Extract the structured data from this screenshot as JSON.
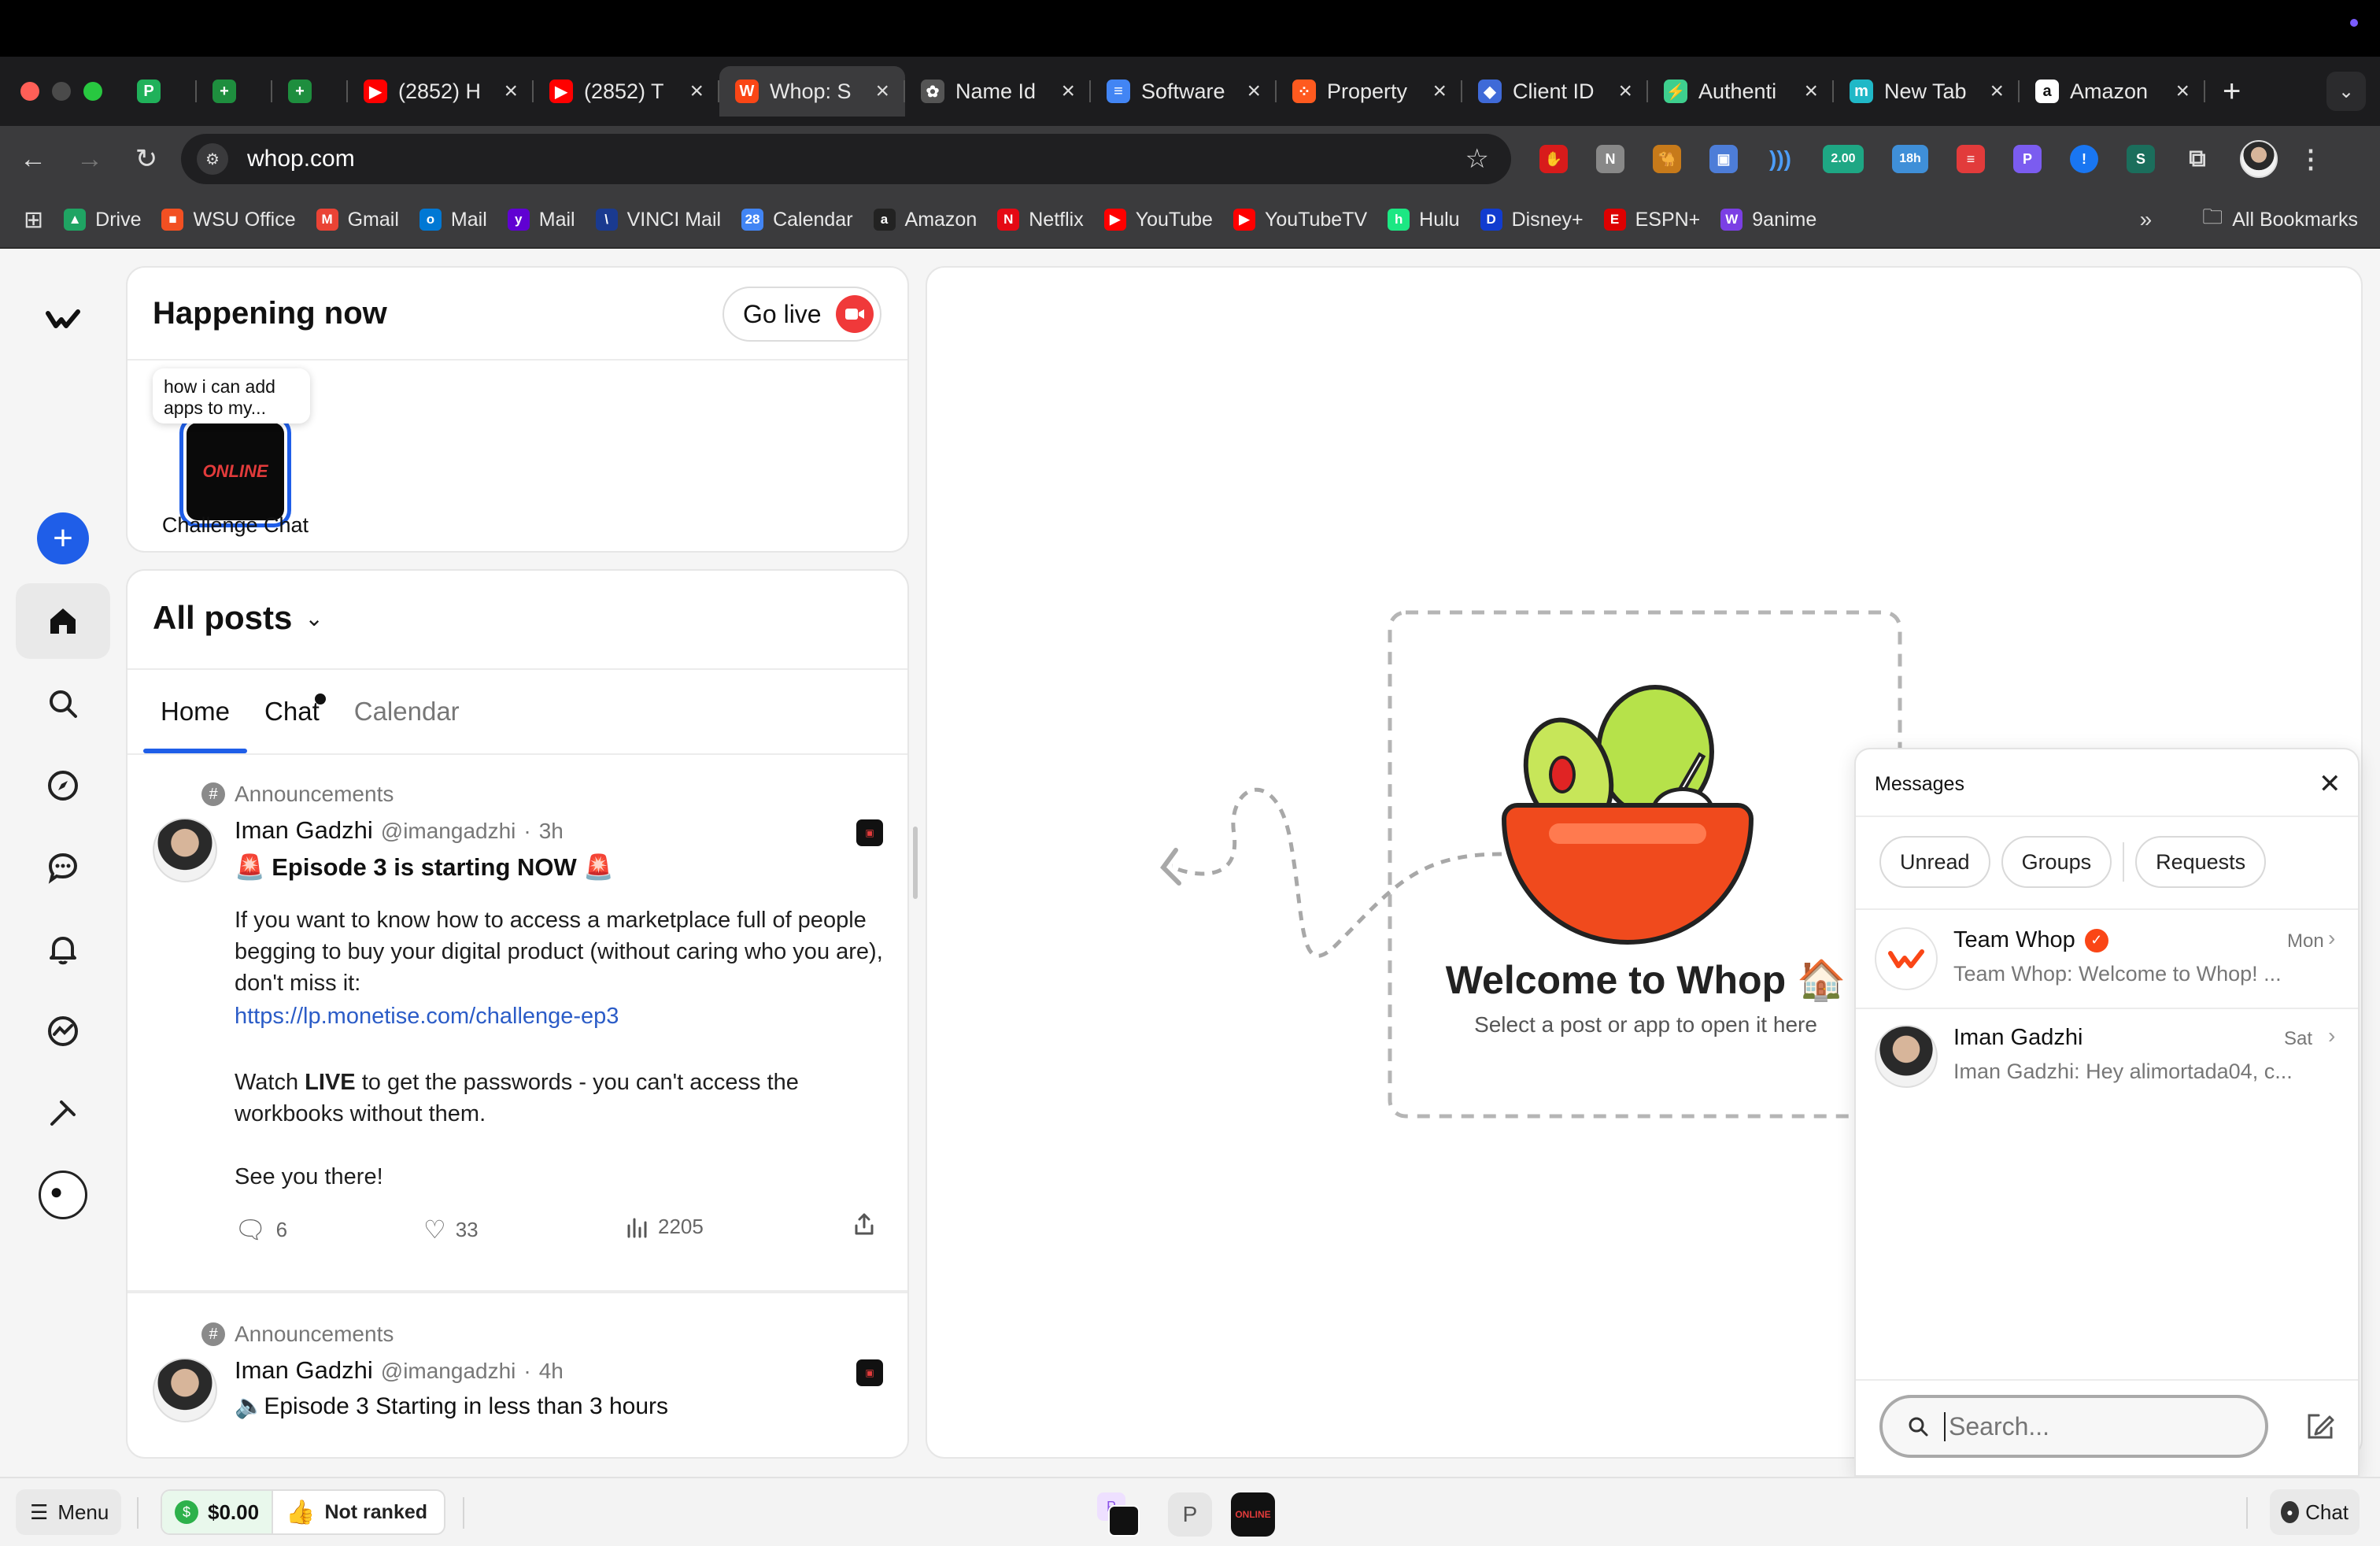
{
  "browser": {
    "tabs": [
      {
        "label": "",
        "icon": "perplexity-icon",
        "color": "#20b15a",
        "letter": "P"
      },
      {
        "label": "",
        "icon": "sheets-icon",
        "color": "#1e8e3e",
        "letter": "+"
      },
      {
        "label": "",
        "icon": "sheets-icon",
        "color": "#1e8e3e",
        "letter": "+"
      },
      {
        "label": "(2852) H",
        "icon": "youtube-icon",
        "color": "#ff0000",
        "letter": "▶"
      },
      {
        "label": "(2852) T",
        "icon": "youtube-icon",
        "color": "#ff0000",
        "letter": "▶"
      },
      {
        "label": "Whop: S",
        "icon": "whop-icon",
        "color": "#fa4616",
        "letter": "W",
        "active": true
      },
      {
        "label": "Name Id",
        "icon": "openai-icon",
        "color": "#555555",
        "letter": "✿"
      },
      {
        "label": "Software",
        "icon": "docs-icon",
        "color": "#4285f4",
        "letter": "≡"
      },
      {
        "label": "Property",
        "icon": "property-icon",
        "color": "#ff5a1f",
        "letter": "⁘"
      },
      {
        "label": "Client ID",
        "icon": "shield-icon",
        "color": "#3f6ad8",
        "letter": "◆"
      },
      {
        "label": "Authenti",
        "icon": "bolt-icon",
        "color": "#3ecf8e",
        "letter": "⚡"
      },
      {
        "label": "New Tab",
        "icon": "m-icon",
        "color": "#20b8c7",
        "letter": "m"
      },
      {
        "label": "Amazon",
        "icon": "amazon-icon",
        "color": "#ffffff",
        "letter": "a"
      }
    ],
    "url": "whop.com",
    "bookmarks": [
      {
        "label": "Drive",
        "color": "#1fa463",
        "letter": "▲"
      },
      {
        "label": "WSU Office",
        "color": "#f25022",
        "letter": "■"
      },
      {
        "label": "Gmail",
        "color": "#ea4335",
        "letter": "M"
      },
      {
        "label": "Mail",
        "color": "#0078d4",
        "letter": "o"
      },
      {
        "label": "Mail",
        "color": "#6001d2",
        "letter": "y"
      },
      {
        "label": "VINCI Mail",
        "color": "#1a3a8f",
        "letter": "\\"
      },
      {
        "label": "Calendar",
        "color": "#4285f4",
        "letter": "28"
      },
      {
        "label": "Amazon",
        "color": "#222222",
        "letter": "a"
      },
      {
        "label": "Netflix",
        "color": "#e50914",
        "letter": "N"
      },
      {
        "label": "YouTube",
        "color": "#ff0000",
        "letter": "▶"
      },
      {
        "label": "YouTubeTV",
        "color": "#ff0000",
        "letter": "▶"
      },
      {
        "label": "Hulu",
        "color": "#1ce783",
        "letter": "h"
      },
      {
        "label": "Disney+",
        "color": "#113ccf",
        "letter": "D"
      },
      {
        "label": "ESPN+",
        "color": "#d00",
        "letter": "E"
      },
      {
        "label": "9anime",
        "color": "#7b3fe4",
        "letter": "W"
      }
    ],
    "all_bookmarks": "All Bookmarks"
  },
  "happening": {
    "title": "Happening now",
    "go_live": "Go live",
    "tooltip": "how i can add apps to my...",
    "story_label": "Challenge Chat"
  },
  "feed": {
    "title": "All posts",
    "tabs": [
      "Home",
      "Chat",
      "Calendar"
    ],
    "posts": [
      {
        "channel": "Announcements",
        "author": "Iman Gadzhi",
        "handle": "@imangadzhi",
        "time": "3h",
        "headline": "🚨 Episode 3 is starting NOW 🚨",
        "p1": "If you want to know how to access a marketplace full of people begging to buy your digital product (without caring who you are), don't miss it:",
        "link": "https://lp.monetise.com/challenge-ep3",
        "p2_pre": "Watch ",
        "p2_bold": "LIVE",
        "p2_post": " to get the passwords - you can't access the workbooks without them.",
        "p3": "See you there!",
        "comments": "6",
        "likes": "33",
        "views": "2205"
      },
      {
        "channel": "Announcements",
        "author": "Iman Gadzhi",
        "handle": "@imangadzhi",
        "time": "4h",
        "headline": "🔈Episode 3 Starting in less than 3 hours"
      }
    ]
  },
  "welcome": {
    "title": "Welcome to Whop 🏠",
    "subtitle": "Select a post or app to open it here"
  },
  "messages": {
    "title": "Messages",
    "filters": [
      "Unread",
      "Groups",
      "Requests"
    ],
    "threads": [
      {
        "name": "Team Whop",
        "verified": true,
        "day": "Mon",
        "preview": "Team Whop: Welcome to Whop! ..."
      },
      {
        "name": "Iman Gadzhi",
        "verified": false,
        "day": "Sat",
        "preview": "Iman Gadzhi: Hey alimortada04, c..."
      }
    ],
    "search_placeholder": "Search..."
  },
  "bottom": {
    "menu": "Menu",
    "balance": "$0.00",
    "rank": "Not ranked",
    "chat": "Chat",
    "p_letter": "P"
  },
  "colors": {
    "whop_orange": "#fa4616",
    "accent_blue": "#1f5ee8",
    "link_blue": "#2b5cc7"
  }
}
